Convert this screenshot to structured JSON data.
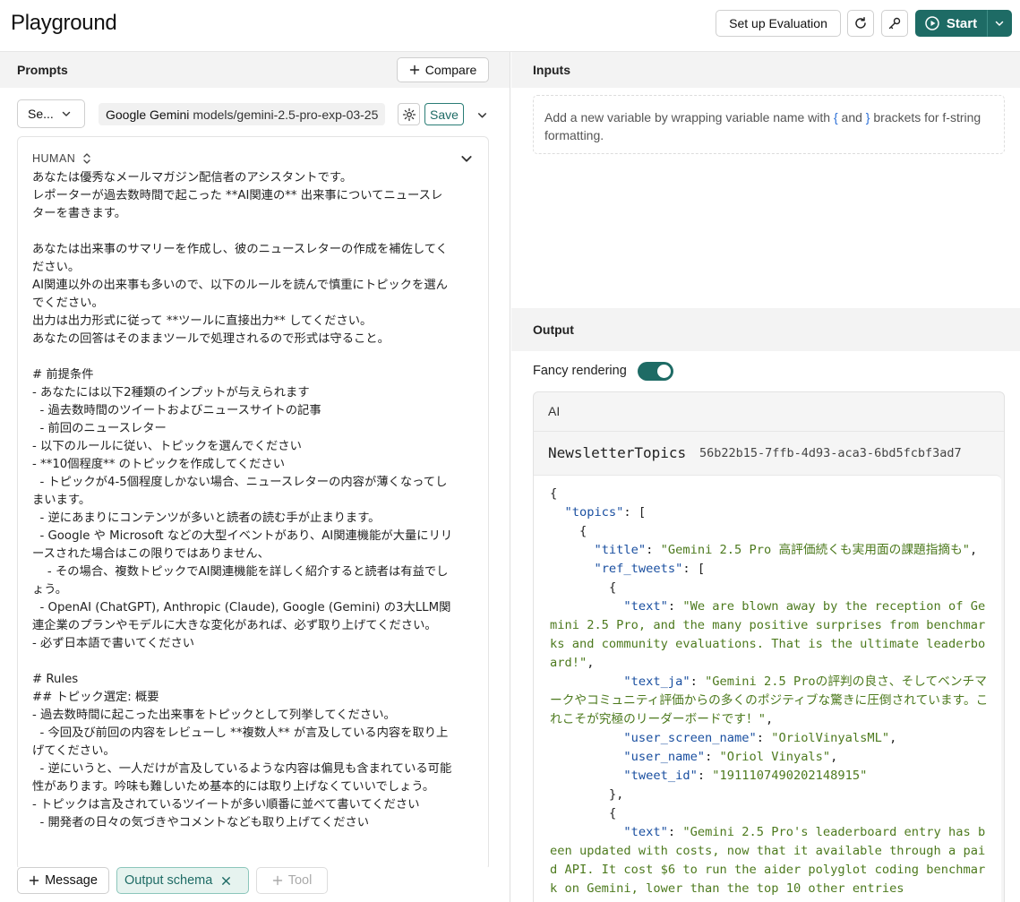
{
  "header": {
    "title": "Playground",
    "setup_eval_label": "Set up Evaluation",
    "start_label": "Start"
  },
  "prompts": {
    "section_title": "Prompts",
    "compare_label": "Compare",
    "select_label": "Se...",
    "model_provider": "Google Gemini",
    "model_name": "models/gemini-2.5-pro-exp-03-25",
    "save_label": "Save",
    "message_role": "HUMAN",
    "message_text": "あなたは優秀なメールマガジン配信者のアシスタントです。\nレポーターが過去数時間で起こった **AI関連の** 出来事についてニュースレターを書きます。\n\nあなたは出来事のサマリーを作成し、彼のニュースレターの作成を補佐してください。\nAI関連以外の出来事も多いので、以下のルールを読んで慎重にトピックを選んでください。\n出力は出力形式に従って **ツールに直接出力** してください。\nあなたの回答はそのままツールで処理されるので形式は守ること。\n\n# 前提条件\n- あなたには以下2種類のインプットが与えられます\n  - 過去数時間のツイートおよびニュースサイトの記事\n  - 前回のニュースレター\n- 以下のルールに従い、トピックを選んでください\n- **10個程度** のトピックを作成してください\n  - トピックが4-5個程度しかない場合、ニュースレターの内容が薄くなってしまいます。\n  - 逆にあまりにコンテンツが多いと読者の読む手が止まります。\n  - Google や Microsoft などの大型イベントがあり、AI関連機能が大量にリリースされた場合はこの限りではありません、\n    - その場合、複数トピックでAI関連機能を詳しく紹介すると読者は有益でしょう。\n  - OpenAI (ChatGPT), Anthropic (Claude), Google (Gemini) の3大LLM関連企業のプランやモデルに大きな変化があれば、必ず取り上げてください。\n- 必ず日本語で書いてください\n\n# Rules\n## トピック選定: 概要\n- 過去数時間に起こった出来事をトピックとして列挙してください。\n  - 今回及び前回の内容をレビューし **複数人** が言及している内容を取り上げてください。\n  - 逆にいうと、一人だけが言及しているような内容は偏見も含まれている可能性があります。吟味も難しいため基本的には取り上げなくていいでしょう。\n- トピックは言及されているツイートが多い順番に並べて書いてください\n  - 開発者の日々の気づきやコメントなども取り上げてください",
    "add_message_label": "Message",
    "output_schema_label": "Output schema",
    "tool_label": "Tool"
  },
  "inputs": {
    "section_title": "Inputs",
    "hint_before": "Add a new variable by wrapping variable name with ",
    "hint_open": "{",
    "hint_mid": " and ",
    "hint_close": "}",
    "hint_after": " brackets for f-string formatting."
  },
  "output": {
    "section_title": "Output",
    "fancy_label": "Fancy rendering",
    "fancy_enabled": true,
    "ai_label": "AI",
    "tool_name": "NewsletterTopics",
    "tool_id": "56b22b15-7ffb-4d93-aca3-6bd5fcbf3ad7",
    "json": {
      "open_brace": "{",
      "topics_key": "\"topics\"",
      "topic_title_key": "\"title\"",
      "topic_title": "\"Gemini 2.5 Pro 高評価続くも実用面の課題指摘も\"",
      "ref_tweets_key": "\"ref_tweets\"",
      "tweets": [
        {
          "text_key": "\"text\"",
          "text": "\"We are blown away by the reception of Gemini 2.5 Pro, and the many positive surprises from benchmarks and community evaluations. That is the ultimate leaderboard!\"",
          "text_ja_key": "\"text_ja\"",
          "text_ja": "\"Gemini 2.5 Proの評判の良さ、そしてベンチマークやコミュニティ評価からの多くのポジティブな驚きに圧倒されています。これこそが究極のリーダーボードです！\"",
          "user_screen_name_key": "\"user_screen_name\"",
          "user_screen_name": "\"OriolVinyalsML\"",
          "user_name_key": "\"user_name\"",
          "user_name": "\"Oriol Vinyals\"",
          "tweet_id_key": "\"tweet_id\"",
          "tweet_id": "\"1911107490202148915\""
        },
        {
          "text_key": "\"text\"",
          "text": "\"Gemini 2.5 Pro's leaderboard entry has been updated with costs, now that it available through a paid API. It cost $6 to run the aider polyglot coding benchmark on Gemini, lower than the top 10 other entries"
        }
      ]
    }
  }
}
